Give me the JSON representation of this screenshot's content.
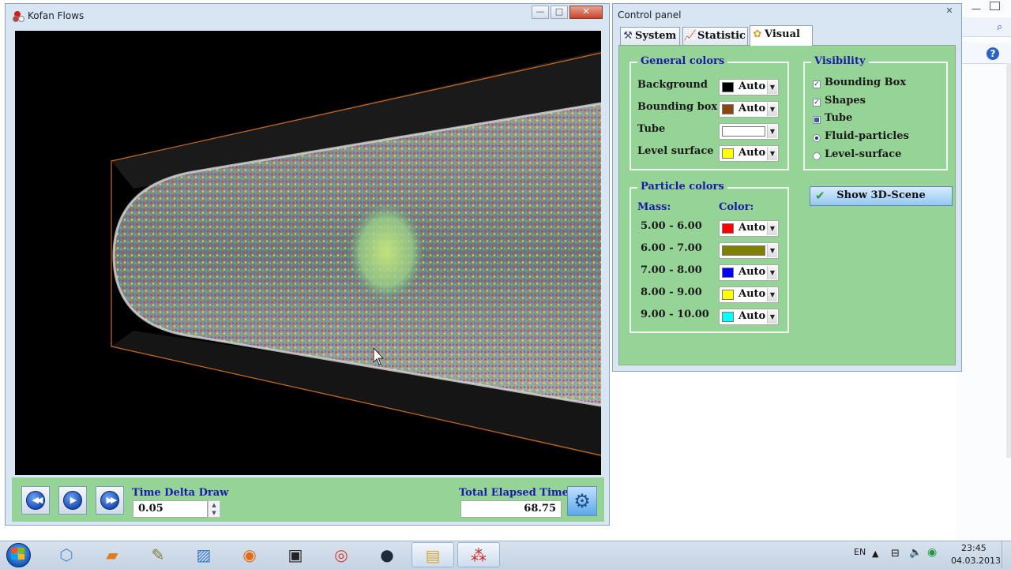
{
  "main_window": {
    "title": "Kofan Flows",
    "controls": {
      "minimize": "—",
      "maximize": "□",
      "close": "✕"
    }
  },
  "playback": {
    "rewind_icon": "fast-backward-icon",
    "play_icon": "play-icon",
    "forward_icon": "fast-forward-icon",
    "time_delta_label": "Time Delta Draw",
    "time_delta_value": "0.05",
    "total_elapsed_label": "Total Elapsed Time",
    "total_elapsed_value": "68.75",
    "settings_icon": "gears-icon"
  },
  "control_panel": {
    "title": "Control panel",
    "tabs": [
      {
        "label": "System",
        "icon": "tools-icon"
      },
      {
        "label": "Statistic",
        "icon": "chart-icon"
      },
      {
        "label": "Visual",
        "icon": "palette-icon"
      }
    ],
    "active_tab": "Visual",
    "general_colors": {
      "title": "General colors",
      "rows": [
        {
          "label": "Background",
          "color": "#000000",
          "value": "Auto"
        },
        {
          "label": "Bounding box",
          "color": "#8b4513",
          "value": "Auto"
        },
        {
          "label": "Tube",
          "color": "#ffffff",
          "value": ""
        },
        {
          "label": "Level surface",
          "color": "#ffff00",
          "value": "Auto"
        }
      ]
    },
    "visibility": {
      "title": "Visibility",
      "items": [
        {
          "label": "Bounding Box",
          "type": "checkbox",
          "state": "checked"
        },
        {
          "label": "Shapes",
          "type": "checkbox",
          "state": "checked"
        },
        {
          "label": "Tube",
          "type": "checkbox",
          "state": "indeterminate"
        },
        {
          "label": "Fluid-particles",
          "type": "radio",
          "state": "selected"
        },
        {
          "label": "Level-surface",
          "type": "radio",
          "state": "unselected"
        }
      ]
    },
    "particle_colors": {
      "title": "Particle colors",
      "mass_header": "Mass:",
      "color_header": "Color:",
      "rows": [
        {
          "range": "5.00 -  6.00",
          "color": "#ff0000",
          "value": "Auto"
        },
        {
          "range": "6.00 -  7.00",
          "color": "#808000",
          "value": ""
        },
        {
          "range": "7.00 -  8.00",
          "color": "#0000ff",
          "value": "Auto"
        },
        {
          "range": "8.00 -  9.00",
          "color": "#ffff00",
          "value": "Auto"
        },
        {
          "range": "9.00 -  10.00",
          "color": "#00ffff",
          "value": "Auto"
        }
      ]
    },
    "show_scene_button": "Show 3D-Scene"
  },
  "taskbar": {
    "language": "EN",
    "time": "23:45",
    "date": "04.03.2013",
    "apps": [
      "3d-box-icon",
      "sublime-text-icon",
      "notepad-icon",
      "paint-icon",
      "firefox-icon",
      "floppy-icon",
      "chrome-icon",
      "steam-icon",
      "explorer-folder-icon",
      "kofan-flows-icon"
    ]
  }
}
